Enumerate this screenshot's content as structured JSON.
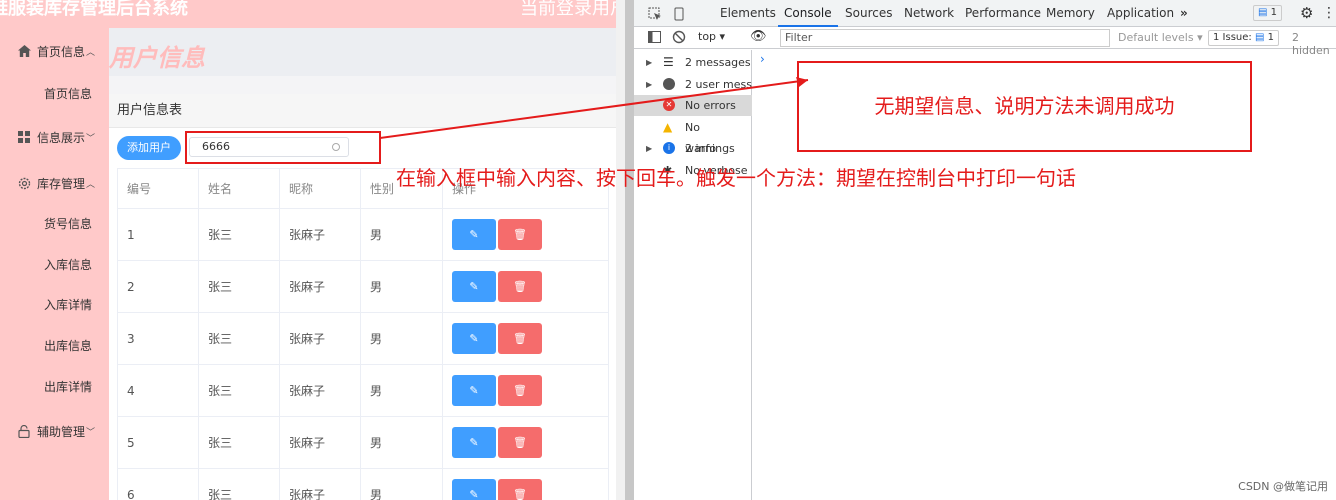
{
  "app": {
    "title": "鞋服装库存管理后台系统",
    "current_user": "当前登录用户",
    "sidebar": [
      {
        "label": "首页信息",
        "children": [
          "首页信息"
        ]
      },
      {
        "label": "信息展示",
        "children": []
      },
      {
        "label": "库存管理",
        "children": [
          "货号信息",
          "入库信息",
          "入库详情",
          "出库信息",
          "出库详情"
        ]
      },
      {
        "label": "辅助管理",
        "children": []
      }
    ],
    "page_title": "用户信息",
    "card_title": "用户信息表",
    "add_button": "添加用户",
    "search_value": "6666",
    "table": {
      "headers": [
        "编号",
        "姓名",
        "昵称",
        "性别",
        "操作"
      ],
      "rows": [
        [
          "1",
          "张三",
          "张麻子",
          "男"
        ],
        [
          "2",
          "张三",
          "张麻子",
          "男"
        ],
        [
          "3",
          "张三",
          "张麻子",
          "男"
        ],
        [
          "4",
          "张三",
          "张麻子",
          "男"
        ],
        [
          "5",
          "张三",
          "张麻子",
          "男"
        ],
        [
          "6",
          "张三",
          "张麻子",
          "男"
        ]
      ]
    }
  },
  "devtools": {
    "tabs": [
      "Elements",
      "Console",
      "Sources",
      "Network",
      "Performance",
      "Memory",
      "Application"
    ],
    "active_tab": "Console",
    "issues_badge": "1",
    "context": "top",
    "filter_placeholder": "Filter",
    "levels": "Default levels",
    "issue_count": "1 Issue:",
    "issue_num": "1",
    "hidden": "2 hidden",
    "sidebar": [
      "2 messages",
      "2 user mess",
      "No errors",
      "No warnings",
      "2 info",
      "No verbose"
    ]
  },
  "annotations": {
    "note1": "在输入框中输入内容、按下回车。触发一个方法：期望在控制台中打印一句话",
    "note2": "无期望信息、说明方法未调用成功",
    "watermark": "CSDN @做笔记用"
  },
  "colors": {
    "primary": "#409eff",
    "danger": "#f56c6c",
    "sidebar": "#ffc9c9",
    "annotation": "#e41b1b"
  }
}
